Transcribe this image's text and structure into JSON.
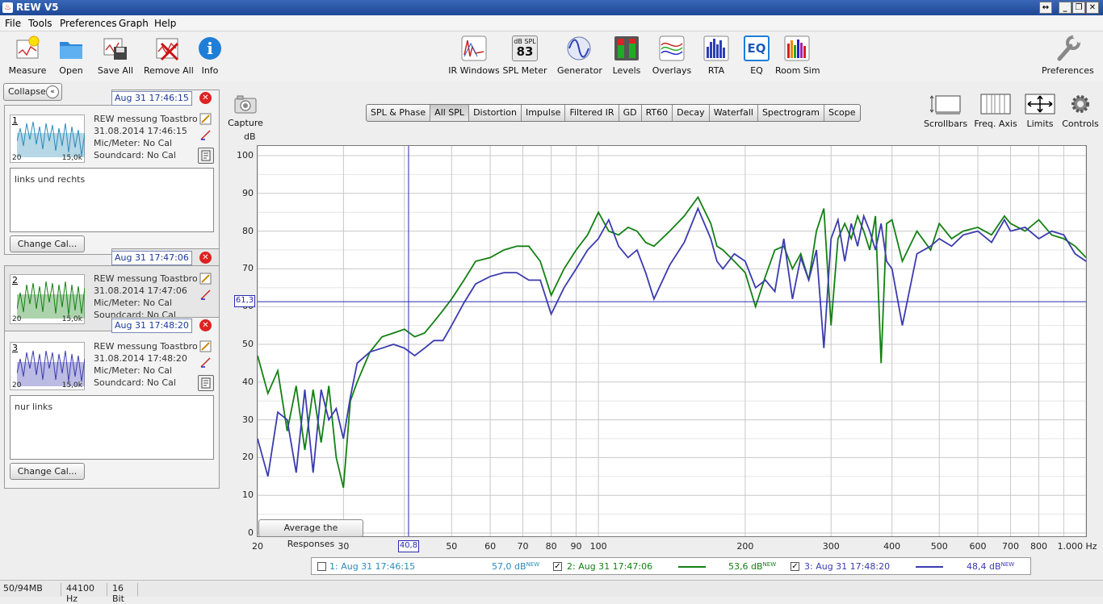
{
  "window": {
    "title": "REW V5"
  },
  "menu": [
    "File",
    "Tools",
    "Preferences",
    "Graph",
    "Help"
  ],
  "toolbar": {
    "measure": "Measure",
    "open": "Open",
    "save_all": "Save All",
    "remove_all": "Remove All",
    "info": "Info",
    "ir_windows": "IR Windows",
    "spl_meter": "SPL Meter",
    "spl_badge_top": "dB SPL",
    "spl_badge_val": "83",
    "generator": "Generator",
    "levels": "Levels",
    "overlays": "Overlays",
    "rta": "RTA",
    "eq": "EQ",
    "eq_badge": "EQ",
    "room_sim": "Room Sim",
    "preferences": "Preferences"
  },
  "left": {
    "collapse": "Collapse"
  },
  "measurements": [
    {
      "num": "1",
      "tab_date": "Aug 31 17:46:15",
      "name": "REW messung Toastbrot'",
      "datetime": "31.08.2014 17:46:15",
      "mic": "Mic/Meter: No Cal",
      "soundcard": "Soundcard: No Cal",
      "notes": "links und rechts",
      "change_cal": "Change Cal...",
      "t20": "20",
      "t15": "15,0k"
    },
    {
      "num": "2",
      "tab_date": "Aug 31 17:47:06",
      "name": "REW messung Toastbrot'",
      "datetime": "31.08.2014 17:47:06",
      "mic": "Mic/Meter: No Cal",
      "soundcard": "Soundcard: No Cal",
      "t20": "20",
      "t15": "15,0k"
    },
    {
      "num": "3",
      "tab_date": "Aug 31 17:48:20",
      "name": "REW messung Toastbrot'",
      "datetime": "31.08.2014 17:48:20",
      "mic": "Mic/Meter: No Cal",
      "soundcard": "Soundcard: No Cal",
      "notes": "nur links",
      "change_cal": "Change Cal...",
      "t20": "20",
      "t15": "15,0k"
    }
  ],
  "graph_tabs": [
    "SPL & Phase",
    "All SPL",
    "Distortion",
    "Impulse",
    "Filtered IR",
    "GD",
    "RT60",
    "Decay",
    "Waterfall",
    "Spectrogram",
    "Scope"
  ],
  "active_tab": "All SPL",
  "right_tools": {
    "capture": "Capture",
    "scrollbars": "Scrollbars",
    "freq_axis": "Freq. Axis",
    "limits": "Limits",
    "controls": "Controls"
  },
  "avg_button": "Average the Responses",
  "cursor": {
    "y_label": "61,3",
    "x_label": "40,8",
    "y": 61.3,
    "x": 40.8
  },
  "legend": [
    {
      "label": "1: Aug 31 17:46:15",
      "value": "57,0 dB",
      "tag": "NEW",
      "checked": false,
      "color": "#2a8cb8"
    },
    {
      "label": "2: Aug 31 17:47:06",
      "value": "53,6 dB",
      "tag": "NEW",
      "checked": true,
      "color": "#138013"
    },
    {
      "label": "3: Aug 31 17:48:20",
      "value": "48,4 dB",
      "tag": "NEW",
      "checked": true,
      "color": "#3b3bb0"
    }
  ],
  "status": {
    "mem": "50/94MB",
    "rate": "44100 Hz",
    "bits": "16 Bit"
  },
  "chart_data": {
    "type": "line",
    "ylabel": "dB",
    "xlabel": "",
    "x_unit": "Hz",
    "x_scale": "log",
    "xlim": [
      20,
      1000
    ],
    "ylim": [
      0,
      100
    ],
    "yticks": [
      "0",
      "10",
      "20",
      "30",
      "40",
      "50",
      "60",
      "70",
      "80",
      "90",
      "100"
    ],
    "xticks": [
      {
        "v": 20,
        "l": "20"
      },
      {
        "v": 30,
        "l": "30"
      },
      {
        "v": 40,
        "l": "40"
      },
      {
        "v": 50,
        "l": "50"
      },
      {
        "v": 60,
        "l": "60"
      },
      {
        "v": 70,
        "l": "70"
      },
      {
        "v": 80,
        "l": "80"
      },
      {
        "v": 90,
        "l": "90"
      },
      {
        "v": 100,
        "l": "100"
      },
      {
        "v": 200,
        "l": "200"
      },
      {
        "v": 300,
        "l": "300"
      },
      {
        "v": 400,
        "l": "400"
      },
      {
        "v": 500,
        "l": "500"
      },
      {
        "v": 600,
        "l": "600"
      },
      {
        "v": 700,
        "l": "700"
      },
      {
        "v": 800,
        "l": "800"
      },
      {
        "v": 1000,
        "l": "1.000 Hz"
      }
    ],
    "series": [
      {
        "color": "#138013",
        "x": [
          20,
          21,
          22,
          23,
          24,
          25,
          26,
          27,
          28,
          29,
          30,
          31,
          32,
          34,
          36,
          38,
          40,
          42,
          44,
          46,
          48,
          50,
          53,
          56,
          60,
          64,
          68,
          72,
          76,
          80,
          85,
          90,
          95,
          100,
          105,
          110,
          115,
          120,
          125,
          130,
          140,
          150,
          160,
          170,
          175,
          180,
          190,
          200,
          210,
          220,
          230,
          240,
          250,
          260,
          270,
          280,
          290,
          300,
          310,
          320,
          330,
          340,
          350,
          360,
          370,
          380,
          390,
          400,
          420,
          450,
          480,
          500,
          530,
          560,
          600,
          640,
          680,
          700,
          750,
          800,
          850,
          900,
          950,
          1000
        ],
        "y": [
          47,
          37,
          43,
          27,
          39,
          22,
          38,
          24,
          39,
          20,
          12,
          35,
          40,
          48,
          52,
          53,
          54,
          52,
          53,
          56,
          59,
          62,
          67,
          72,
          73,
          75,
          76,
          76,
          72,
          63,
          70,
          75,
          79,
          85,
          80,
          79,
          81,
          80,
          77,
          76,
          80,
          84,
          89,
          82,
          76,
          75,
          72,
          69,
          60,
          68,
          75,
          76,
          70,
          74,
          67,
          80,
          86,
          55,
          78,
          82,
          78,
          84,
          80,
          75,
          84,
          45,
          82,
          83,
          72,
          80,
          75,
          82,
          78,
          80,
          81,
          79,
          84,
          82,
          80,
          83,
          79,
          78,
          76,
          73
        ]
      },
      {
        "color": "#3b3bb0",
        "x": [
          20,
          21,
          22,
          23,
          24,
          25,
          26,
          27,
          28,
          29,
          30,
          31,
          32,
          34,
          36,
          38,
          40,
          42,
          44,
          46,
          48,
          50,
          53,
          56,
          60,
          64,
          68,
          72,
          76,
          80,
          85,
          90,
          95,
          100,
          105,
          110,
          115,
          120,
          125,
          130,
          140,
          150,
          160,
          170,
          175,
          180,
          190,
          200,
          210,
          220,
          230,
          240,
          250,
          260,
          270,
          280,
          290,
          300,
          310,
          320,
          330,
          340,
          350,
          360,
          370,
          380,
          390,
          400,
          420,
          450,
          480,
          500,
          530,
          560,
          600,
          640,
          680,
          700,
          750,
          800,
          850,
          900,
          950,
          1000
        ],
        "y": [
          25,
          15,
          32,
          30,
          16,
          38,
          16,
          38,
          30,
          33,
          25,
          36,
          45,
          48,
          49,
          50,
          49,
          47,
          49,
          51,
          51,
          55,
          61,
          66,
          68,
          69,
          69,
          67,
          67,
          58,
          65,
          70,
          75,
          78,
          83,
          76,
          73,
          75,
          69,
          62,
          71,
          77,
          86,
          78,
          72,
          70,
          74,
          72,
          65,
          67,
          64,
          78,
          62,
          73,
          67,
          75,
          49,
          78,
          83,
          72,
          82,
          76,
          84,
          80,
          75,
          82,
          72,
          70,
          55,
          74,
          76,
          78,
          76,
          79,
          80,
          77,
          83,
          80,
          81,
          78,
          80,
          79,
          74,
          72
        ]
      }
    ]
  }
}
